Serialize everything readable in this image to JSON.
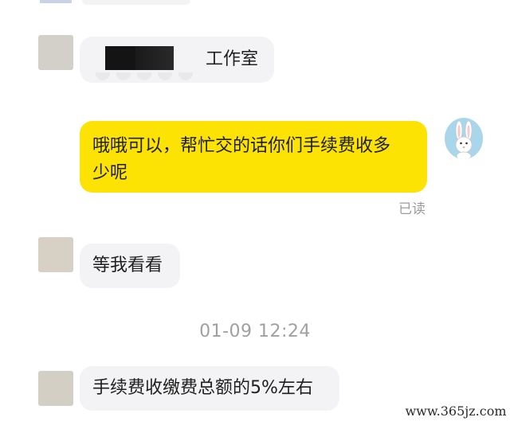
{
  "messages": [
    {
      "side": "left",
      "text": "工作室",
      "redacted": true
    },
    {
      "side": "right",
      "text_line1": "哦哦可以，帮忙交的话你们手续费收多",
      "text_line2": "少呢",
      "status": "已读",
      "avatar_icon": "rabbit-avatar-icon"
    },
    {
      "side": "left",
      "text": "等我看看"
    },
    {
      "side": "left",
      "text": "手续费收缴费总额的5%左右"
    }
  ],
  "timestamp": "01-09 12:24",
  "watermark": "www.365jz.com",
  "colors": {
    "right_bubble": "#fce303",
    "left_bubble": "#f3f3f5",
    "avatar_gray_1": "#d3d0ca",
    "avatar_gray_2": "#d6d1c4",
    "avatar_gray_3": "#d4cfc4",
    "avatar_bg_rabbit": "#a9d6ea",
    "timestamp_text": "#9fa0a3"
  }
}
